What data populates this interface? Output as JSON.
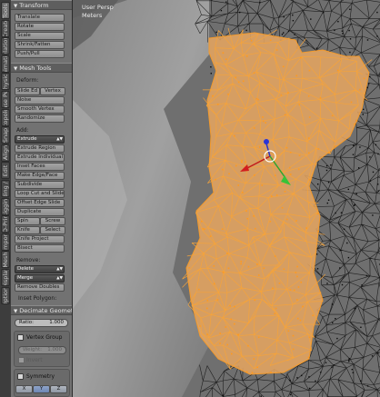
{
  "tabs": [
    "Tools",
    "Create",
    "Relations",
    "Animation",
    "Physics",
    "Grease Pencil",
    "Retopology",
    "Snap",
    "Align",
    "Edit",
    "Shading / UVs",
    "Rigging",
    "3D-Print",
    "Import",
    "Mesh",
    "Display",
    "Options"
  ],
  "panel": {
    "transform": {
      "header": "Transform",
      "buttons": [
        "Translate",
        "Rotate",
        "Scale",
        "Shrink/Fatten",
        "Push/Pull"
      ]
    },
    "mesh_tools": {
      "header": "Mesh Tools",
      "deform_label": "Deform:",
      "slide_edge": "Slide Ed",
      "vertex": "Vertex",
      "noise": "Noise",
      "smooth_vertex": "Smooth Vertex",
      "randomize": "Randomize",
      "add_label": "Add:",
      "extrude_dropdown": "Extrude",
      "add_buttons": [
        "Extrude Region",
        "Extrude Individual",
        "Inset Faces",
        "Make Edge/Face",
        "Subdivide",
        "Loop Cut and Slide",
        "Offset Edge Slide",
        "Duplicate"
      ],
      "spin": "Spin",
      "screw": "Screw",
      "knife": "Knife",
      "select": "Select",
      "knife_project": "Knife Project",
      "bisect": "Bisect",
      "remove_label": "Remove:",
      "delete_dropdown": "Delete",
      "merge_dropdown": "Merge",
      "remove_doubles": "Remove Doubles"
    },
    "operator": {
      "title": "Inset Polygon:",
      "header": "Decimate Geometry",
      "ratio_label": "Ratio:",
      "ratio_value": "1.000",
      "vertex_group_label": "Vertex Group",
      "weight_label": "Weight:",
      "weight_value": "1.000",
      "invert_label": "Invert",
      "symmetry_label": "Symmetry",
      "axes": [
        "X",
        "Y",
        "Z"
      ]
    }
  },
  "viewport": {
    "view_name": "User Persp",
    "units": "Meters"
  },
  "colors": {
    "selection": "#f39a2c",
    "selection_fill": "#e9a760",
    "wire": "#0f0f0f",
    "panel_bg": "#727272",
    "button": "#999999"
  }
}
